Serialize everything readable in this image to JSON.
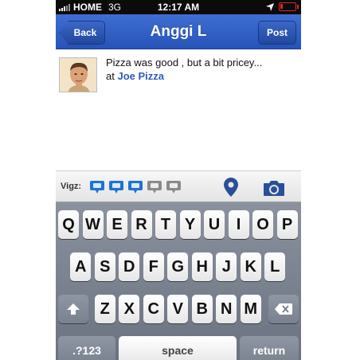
{
  "status_bar": {
    "carrier": "HOME",
    "network": "3G",
    "time": "12:17 AM"
  },
  "nav": {
    "title": "Anggi L",
    "back_label": "Back",
    "post_label": "Post"
  },
  "post": {
    "text": "Pizza was good , but a bit pricey...",
    "at_label": "at",
    "place": "Joe Pizza"
  },
  "toolbar": {
    "vigz_label": "Vigz:",
    "rating": {
      "filled": 3,
      "total": 5
    },
    "location_icon": "map-pin-icon",
    "camera_icon": "camera-icon"
  },
  "keyboard": {
    "row1": [
      "Q",
      "W",
      "E",
      "R",
      "T",
      "Y",
      "U",
      "I",
      "O",
      "P"
    ],
    "row2": [
      "A",
      "S",
      "D",
      "F",
      "G",
      "H",
      "J",
      "K",
      "L"
    ],
    "row3": [
      "Z",
      "X",
      "C",
      "V",
      "B",
      "N",
      "M"
    ],
    "numbers_label": ".?123",
    "space_label": "space",
    "return_label": "return"
  },
  "colors": {
    "nav_blue": "#2e5fc4",
    "rating_blue": "#1e73d8",
    "rating_gray": "#8a8a8a",
    "link_blue": "#2d5bb9"
  }
}
